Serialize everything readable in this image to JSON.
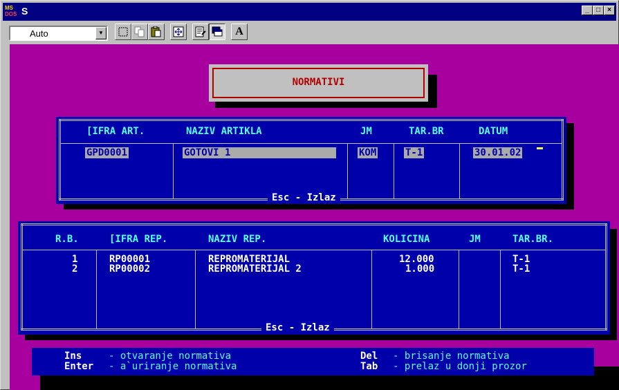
{
  "window": {
    "title": "S",
    "icon_text_top": "MS",
    "icon_text_bottom": "DOS",
    "controls": {
      "minimize": "_",
      "maximize": "□",
      "close": "×"
    }
  },
  "toolbar": {
    "font_combo_value": "Auto",
    "buttons": [
      "mark-icon",
      "copy-icon",
      "paste-icon",
      "fullscreen-icon",
      "properties-icon",
      "background-icon",
      "font-icon"
    ],
    "font_button_label": "A"
  },
  "dos": {
    "title": "NORMATIVI",
    "upper": {
      "headers": {
        "sifra": "[IFRA ART.",
        "naziv": "NAZIV ARTIKLA",
        "jm": "JM",
        "tarbr": "TAR.BR",
        "datum": "DATUM"
      },
      "row": {
        "sifra": "GPD0001",
        "naziv": "GOTOVI 1",
        "jm": "KOM",
        "tarbr": "T-1",
        "datum": "30.01.02"
      },
      "footer": "Esc - Izlaz"
    },
    "lower": {
      "headers": {
        "rb": "R.B.",
        "sifra": "[IFRA REP.",
        "naziv": "NAZIV REP.",
        "kolicina": "KOLICINA",
        "jm": "JM",
        "tarbr": "TAR.BR."
      },
      "rows": [
        {
          "rb": "1",
          "sifra": "RP00001",
          "naziv": "REPROMATERIJAL",
          "kolicina": "12.000",
          "jm": "",
          "tarbr": "T-1"
        },
        {
          "rb": "2",
          "sifra": "RP00002",
          "naziv": "REPROMATERIJAL 2",
          "kolicina": "1.000",
          "jm": "",
          "tarbr": "T-1"
        }
      ],
      "footer": "Esc - Izlaz"
    },
    "help": [
      {
        "key": "Ins",
        "desc": "- otvaranje normativa"
      },
      {
        "key": "Enter",
        "desc": "- a`uriranje normativa"
      },
      {
        "key": "Del",
        "desc": "- brisanje normativa"
      },
      {
        "key": "Tab",
        "desc": "- prelaz u donji prozor"
      }
    ]
  }
}
